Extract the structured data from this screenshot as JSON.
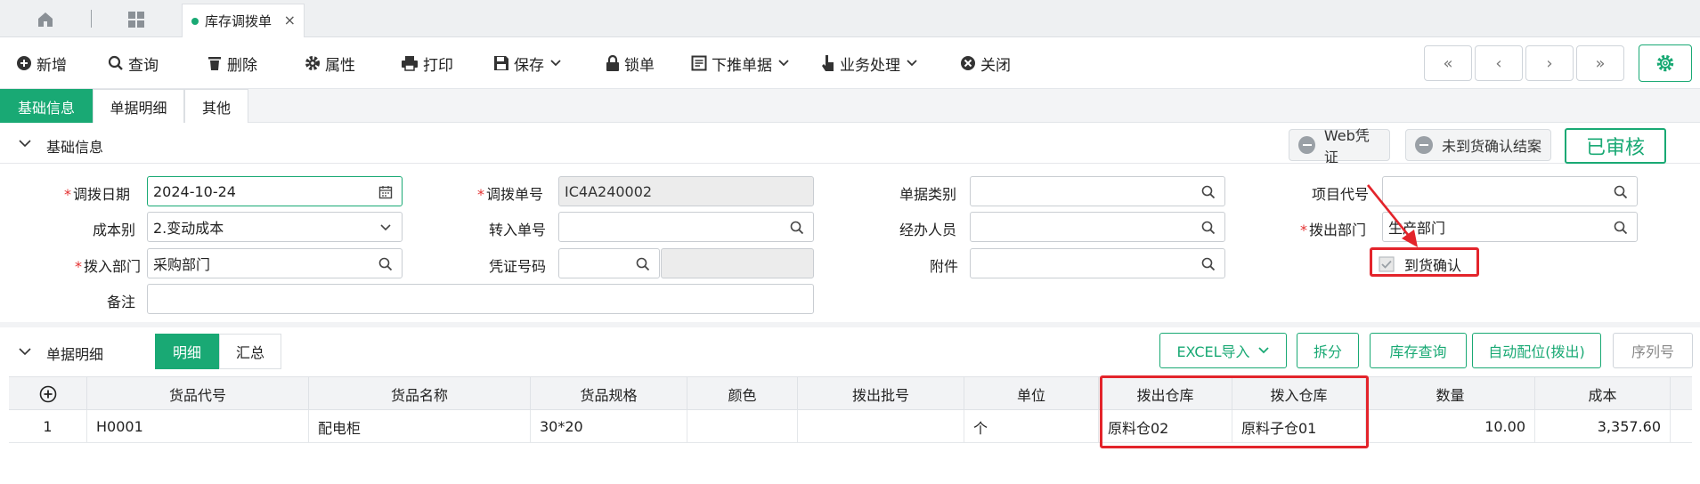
{
  "tabbar": {
    "active_tab": "库存调拨单",
    "close": "×"
  },
  "toolbar": {
    "add": "新增",
    "query": "查询",
    "delete": "删除",
    "properties": "属性",
    "print": "打印",
    "save": "保存",
    "lock": "锁单",
    "push_down": "下推单据",
    "business": "业务处理",
    "close": "关闭",
    "nav_first": "«",
    "nav_prev": "‹",
    "nav_next": "›",
    "nav_last": "»"
  },
  "section_tabs": [
    "基础信息",
    "单据明细",
    "其他"
  ],
  "basic_section": {
    "title": "基础信息",
    "web_voucher": "Web凭证",
    "unarrived_settle": "未到货确认结案",
    "status": "已审核"
  },
  "form": {
    "transfer_date_label": "调拨日期",
    "transfer_date": "2024-10-24",
    "transfer_no_label": "调拨单号",
    "transfer_no": "IC4A240002",
    "doc_type_label": "单据类别",
    "doc_type": "",
    "project_code_label": "项目代号",
    "project_code": "",
    "cost_type_label": "成本别",
    "cost_type": "2.变动成本",
    "in_doc_no_label": "转入单号",
    "in_doc_no": "",
    "handler_label": "经办人员",
    "handler": "",
    "out_dept_label": "拨出部门",
    "out_dept": "生产部门",
    "in_dept_label": "拨入部门",
    "in_dept": "采购部门",
    "voucher_no_label": "凭证号码",
    "voucher_no": "",
    "attachment_label": "附件",
    "attachment": "",
    "arrival_confirm_label": "到货确认",
    "arrival_confirm_checked": true,
    "remark_label": "备注",
    "remark": ""
  },
  "detail_section": {
    "title": "单据明细",
    "tab_detail": "明细",
    "tab_summary": "汇总",
    "excel_import": "EXCEL导入",
    "split": "拆分",
    "stock_query": "库存查询",
    "auto_allocate": "自动配位(拨出)",
    "serial_no": "序列号"
  },
  "grid": {
    "columns": [
      "货品代号",
      "货品名称",
      "货品规格",
      "颜色",
      "拨出批号",
      "单位",
      "拨出仓库",
      "拨入仓库",
      "数量",
      "成本"
    ],
    "rows": [
      {
        "idx": "1",
        "code": "H0001",
        "name": "配电柜",
        "spec": "30*20",
        "color": "",
        "batch": "",
        "unit": "个",
        "out_wh": "原料仓02",
        "in_wh": "原料子仓01",
        "qty": "10.00",
        "cost": "3,357.60"
      }
    ]
  },
  "colors": {
    "accent": "#19a974",
    "highlight": "#e3242b"
  }
}
